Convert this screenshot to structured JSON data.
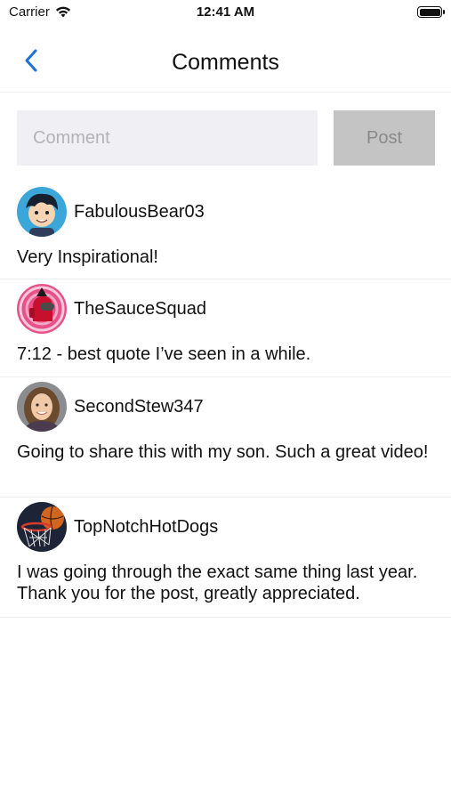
{
  "status_bar": {
    "carrier": "Carrier",
    "time": "12:41 AM"
  },
  "nav": {
    "title": "Comments",
    "back_icon": "chevron-left-icon"
  },
  "composer": {
    "placeholder": "Comment",
    "value": "",
    "post_label": "Post"
  },
  "colors": {
    "accent": "#1f6fd8",
    "input_bg": "#efeff4",
    "post_bg": "#c4c4c4",
    "divider": "#eeeeee"
  },
  "comments": [
    {
      "username": "FabulousBear03",
      "text": "Very Inspirational!",
      "avatar": "cartoon-boy-avatar"
    },
    {
      "username": "TheSauceSquad",
      "text": "7:12 - best quote I’ve seen in a while.",
      "avatar": "red-crewmate-avatar"
    },
    {
      "username": "SecondStew347",
      "text": "Going to share this with my son. Such a great video!",
      "avatar": "woman-photo-avatar"
    },
    {
      "username": "TopNotchHotDogs",
      "text": "I was going through the exact same thing last year. Thank you for the post, greatly appreciated.",
      "avatar": "basketball-hoop-avatar"
    }
  ]
}
